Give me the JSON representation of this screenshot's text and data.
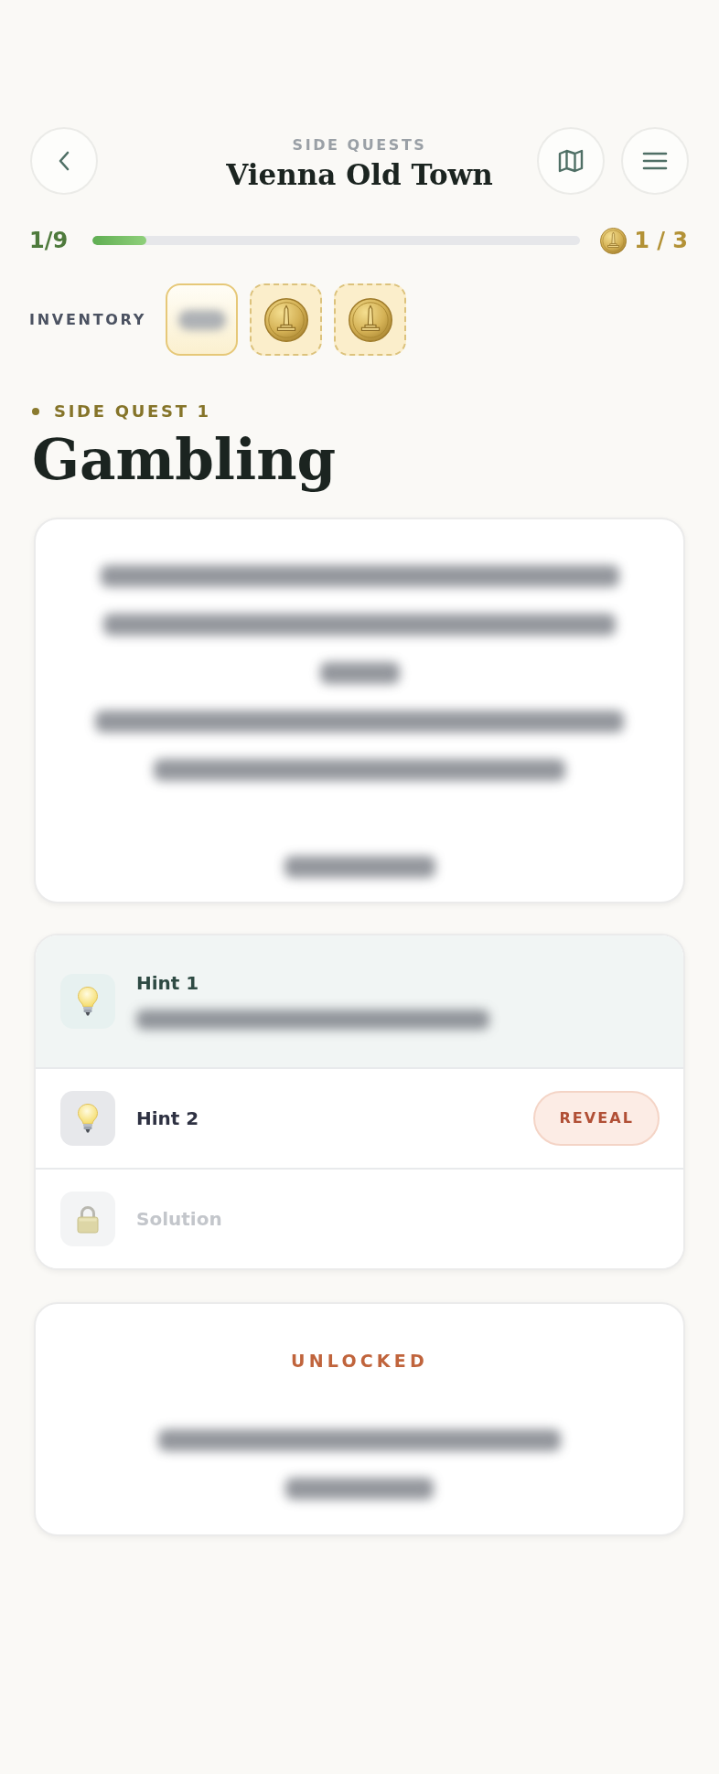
{
  "header": {
    "eyebrow": "SIDE QUESTS",
    "title": "Vienna Old Town"
  },
  "progress": {
    "label": "1/9",
    "level": 0.11
  },
  "coins": {
    "label": "1 / 3"
  },
  "inventory": {
    "label": "INVENTORY",
    "items": [
      {
        "kind": "item",
        "selected": true
      },
      {
        "kind": "coin",
        "selected": false
      },
      {
        "kind": "coin",
        "selected": false
      }
    ]
  },
  "quest": {
    "eyebrow": "SIDE QUEST 1",
    "title": "Gambling"
  },
  "hints": [
    {
      "kind": "hint",
      "title": "Hint 1",
      "revealed": true,
      "locked": false
    },
    {
      "kind": "hint",
      "title": "Hint 2",
      "revealed": false,
      "locked": false,
      "button": "REVEAL"
    },
    {
      "kind": "solution",
      "title": "Solution",
      "revealed": false,
      "locked": true
    }
  ],
  "unlocked": {
    "label": "UNLOCKED"
  }
}
